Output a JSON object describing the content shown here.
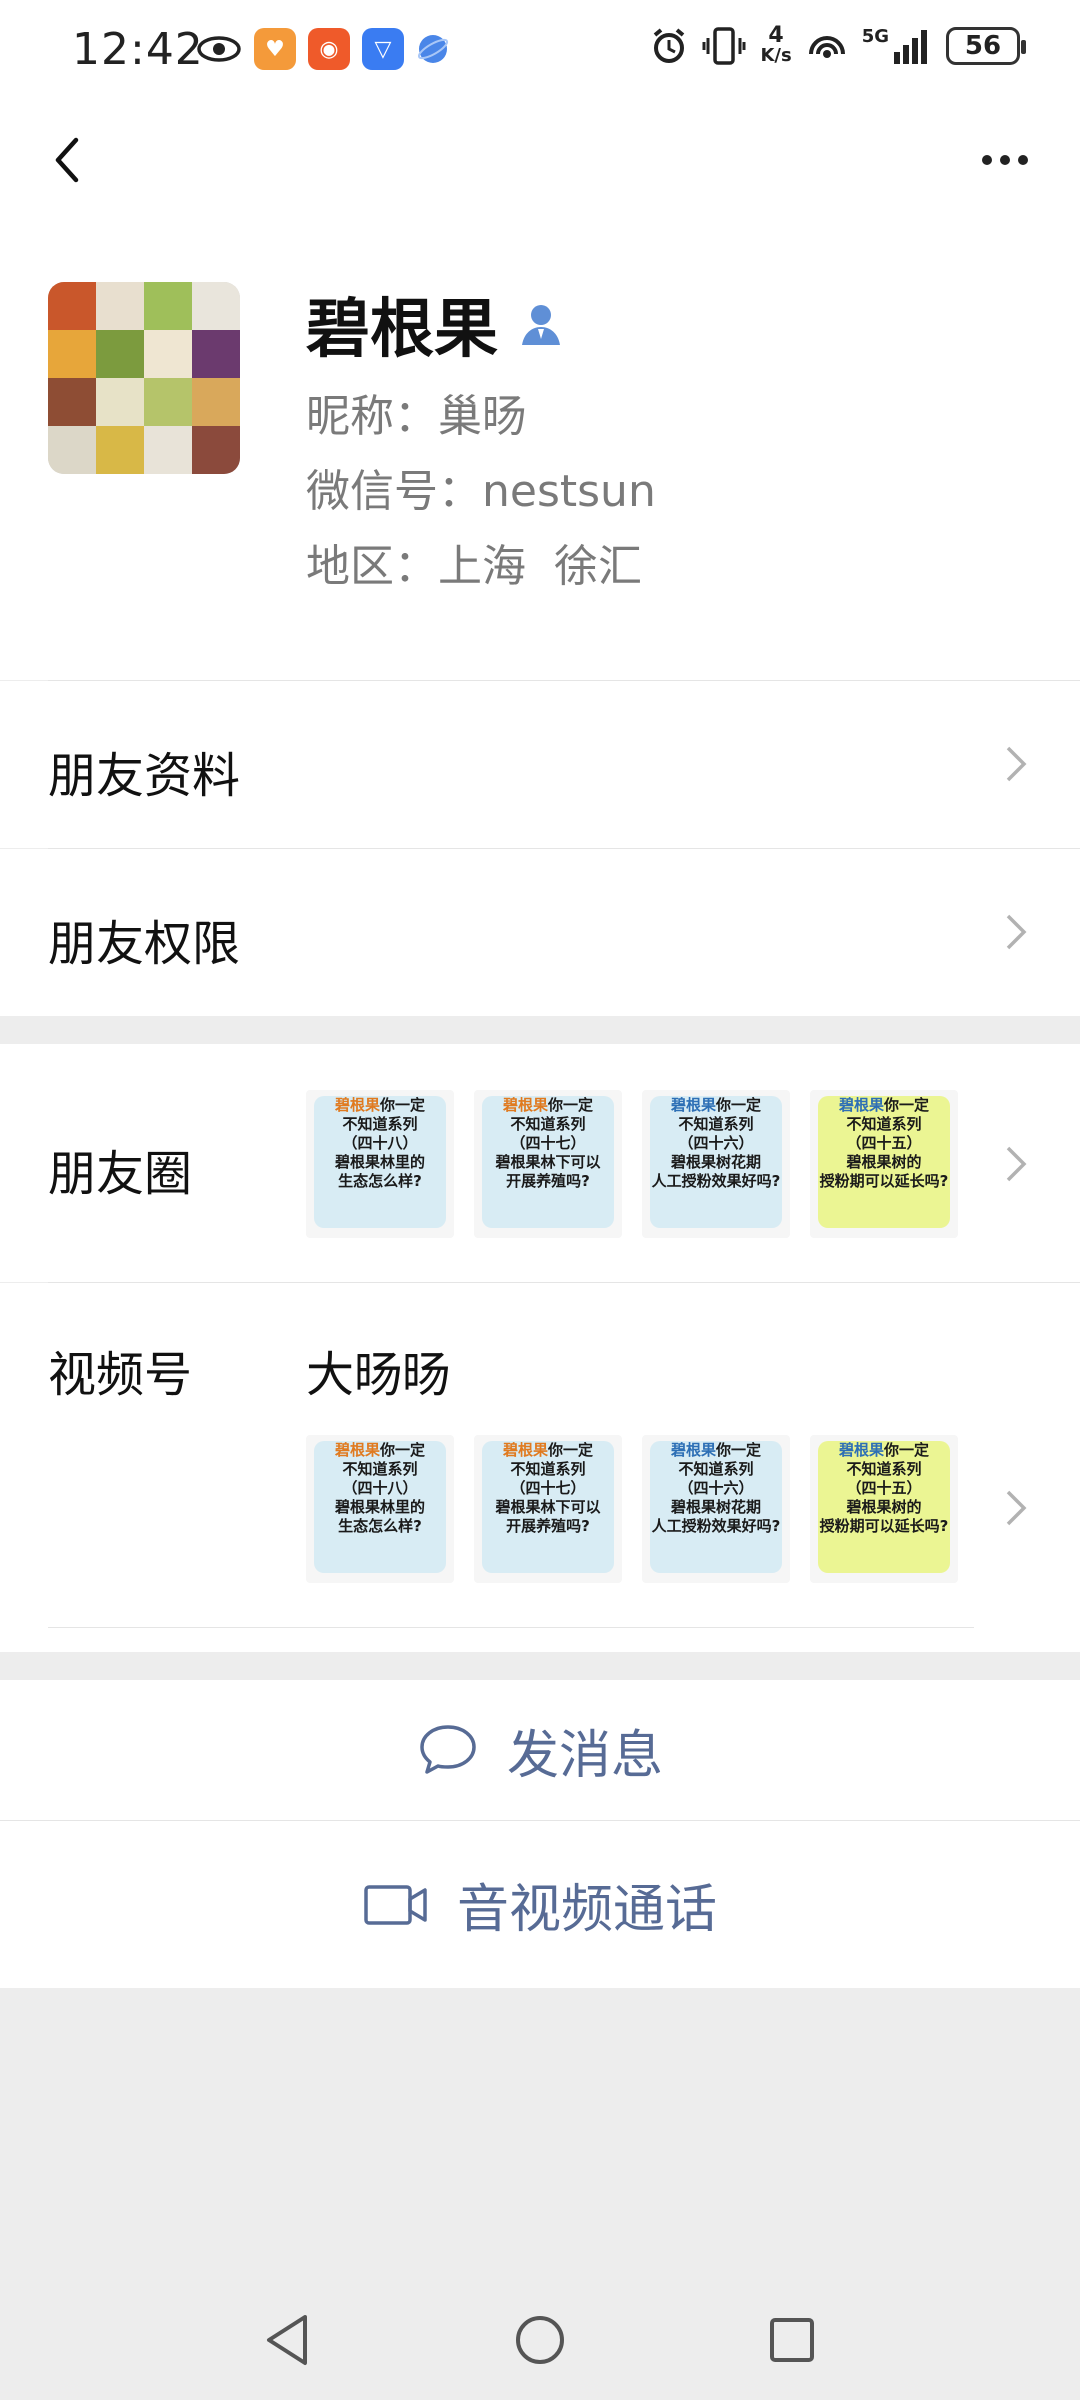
{
  "status_bar": {
    "time": "12:42",
    "network_speed_value": "4",
    "network_speed_unit": "K/s",
    "signal_label": "5G",
    "battery": "56"
  },
  "profile": {
    "name": "碧根果",
    "nickname": "昵称：巢旸",
    "wechat_id": "微信号：nestsun",
    "region": "地区：上海  徐汇"
  },
  "rows": {
    "friend_info": "朋友资料",
    "friend_permissions": "朋友权限",
    "moments": "朋友圈",
    "channels": "视频号",
    "channels_name": "大旸旸"
  },
  "moments_thumbs": [
    {
      "line1a": "碧根果",
      "line1b": "你一定",
      "line2": "不知道系列",
      "line3": "（四十八）",
      "line4": "碧根果林里的",
      "line5": "生态怎么样?",
      "color": "#bfe3f2"
    },
    {
      "line1a": "碧根果",
      "line1b": "你一定",
      "line2": "不知道系列",
      "line3": "（四十七）",
      "line4": "碧根果林下可以",
      "line5": "开展养殖吗?",
      "color": "#bfe3f2"
    },
    {
      "line1a": "碧根果",
      "line1b": "你一定",
      "line2": "不知道系列",
      "line3": "（四十六）",
      "line4": "碧根果树花期",
      "line5": "人工授粉效果好吗?",
      "color": "#bfe3f2"
    },
    {
      "line1a": "碧根果",
      "line1b": "你一定",
      "line2": "不知道系列",
      "line3": "（四十五）",
      "line4": "碧根果树的",
      "line5": "授粉期可以延长吗?",
      "color": "#e8f57a"
    }
  ],
  "actions": {
    "message": "发消息",
    "call": "音视频通话"
  },
  "colors": {
    "link_blue": "#576b95",
    "background": "#ededed"
  }
}
